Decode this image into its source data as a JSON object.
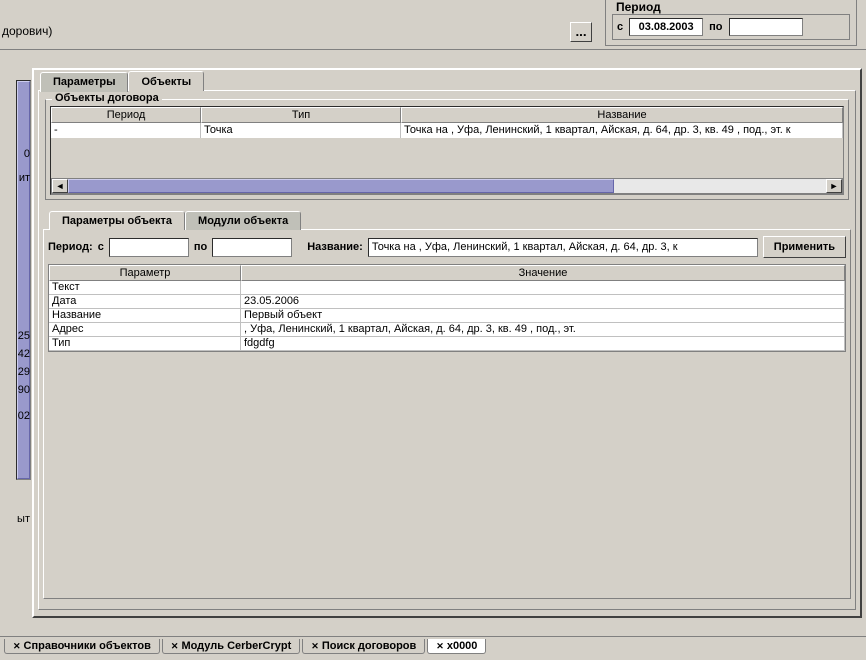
{
  "top": {
    "text_fragment": "дорович)"
  },
  "period_group": {
    "label": "Период",
    "from_label": "с",
    "from_value": "03.08.2003",
    "to_label": "по",
    "to_value": ""
  },
  "ellipsis": "...",
  "left_values": [
    "0",
    "ит",
    "25",
    "42",
    "29",
    "90",
    "02",
    "ыт"
  ],
  "tabs": {
    "params": "Параметры",
    "objects": "Объекты"
  },
  "contract_objects": {
    "label": "Объекты договора",
    "headers": {
      "period": "Период",
      "type": "Тип",
      "name": "Название"
    },
    "row": {
      "period": "-",
      "type": "Точка",
      "name": "Точка на , Уфа, Ленинский, 1 квартал, Айская, д. 64, др. 3, кв. 49 ,  под.,  эт. к"
    }
  },
  "sub_tabs": {
    "object_params": "Параметры объекта",
    "object_modules": "Модули объекта"
  },
  "filter": {
    "period_label": "Период:",
    "from_label": "с",
    "to_label": "по",
    "from_value": "",
    "to_value": "",
    "name_label": "Название:",
    "name_value": "Точка на , Уфа, Ленинский, 1 квартал, Айская, д. 64, др. 3, к",
    "apply": "Применить"
  },
  "params_grid": {
    "headers": {
      "param": "Параметр",
      "value": "Значение"
    },
    "rows": [
      {
        "param": "Текст",
        "value": ""
      },
      {
        "param": "Дата",
        "value": "23.05.2006"
      },
      {
        "param": "Название",
        "value": "Первый объект"
      },
      {
        "param": "Адрес",
        "value": ", Уфа, Ленинский, 1 квартал, Айская, д. 64, др. 3, кв. 49 ,  под.,  эт."
      },
      {
        "param": "Тип",
        "value": "fdgdfg"
      }
    ]
  },
  "bottom_tabs": {
    "t1": "Справочники объектов",
    "t2": "Модуль CerberCrypt",
    "t3": "Поиск договоров",
    "t4": "x0000"
  }
}
